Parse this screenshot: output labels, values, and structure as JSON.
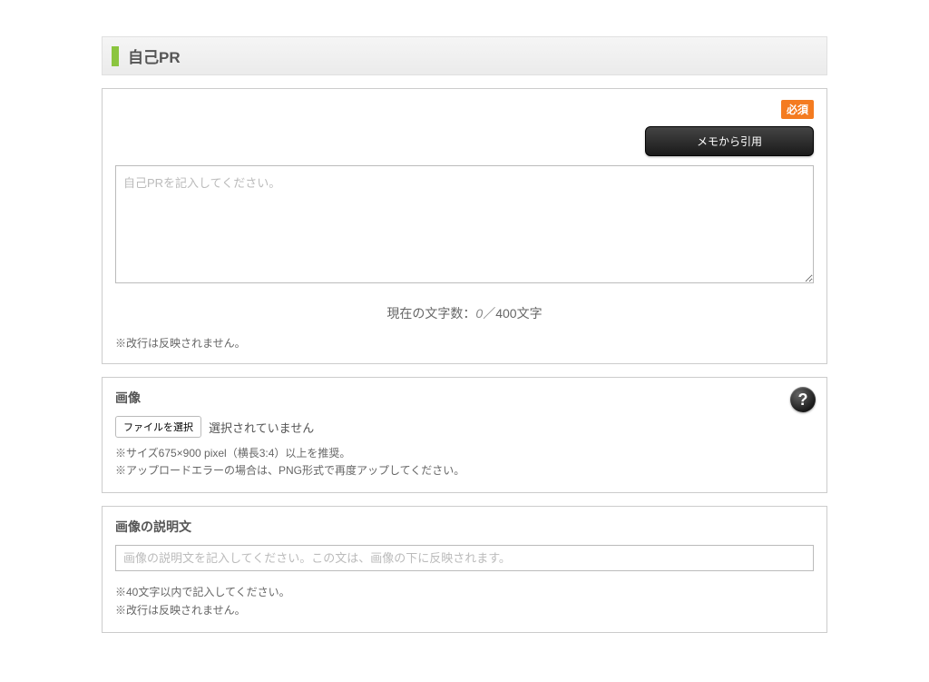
{
  "section": {
    "title": "自己PR"
  },
  "pr_panel": {
    "required_badge": "必須",
    "quote_button": "メモから引用",
    "textarea_placeholder": "自己PRを記入してください。",
    "char_count_prefix": "現在の文字数：",
    "char_count_value": "0",
    "char_count_suffix": "／400文字",
    "note_newline": "※改行は反映されません。"
  },
  "image_panel": {
    "label": "画像",
    "file_button": "ファイルを選択",
    "file_status": "選択されていません",
    "note_size": "※サイズ675×900 pixel（横長3:4）以上を推奨。",
    "note_upload": "※アップロードエラーの場合は、PNG形式で再度アップしてください。",
    "help_icon": "?"
  },
  "caption_panel": {
    "label": "画像の説明文",
    "input_placeholder": "画像の説明文を記入してください。この文は、画像の下に反映されます。",
    "note_limit": "※40文字以内で記入してください。",
    "note_newline": "※改行は反映されません。"
  }
}
